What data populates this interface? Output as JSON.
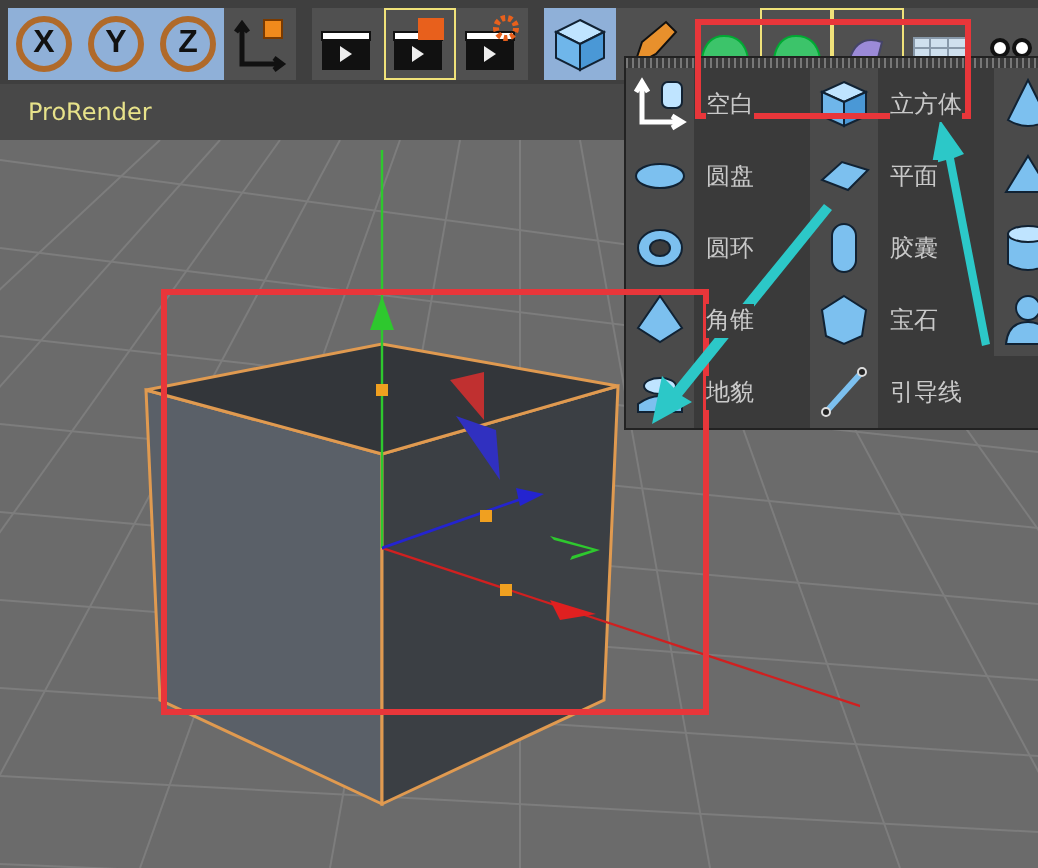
{
  "toolbar": {
    "groups": [
      {
        "items": [
          {
            "kind": "axis",
            "label": "X",
            "selected": true,
            "outlined": false
          },
          {
            "kind": "axis",
            "label": "Y",
            "selected": true,
            "outlined": false
          },
          {
            "kind": "axis",
            "label": "Z",
            "selected": true,
            "outlined": false
          },
          {
            "kind": "coord",
            "selected": false,
            "outlined": false
          }
        ]
      },
      {
        "items": [
          {
            "kind": "clap",
            "selected": false,
            "outlined": false
          },
          {
            "kind": "clap-edit",
            "selected": false,
            "outlined": true
          },
          {
            "kind": "clap-gear",
            "selected": false,
            "outlined": false
          }
        ]
      },
      {
        "items": [
          {
            "kind": "cube",
            "selected": true,
            "outlined": false
          },
          {
            "kind": "pen",
            "selected": false,
            "outlined": false
          },
          {
            "kind": "green",
            "selected": false,
            "outlined": false
          },
          {
            "kind": "green",
            "selected": false,
            "outlined": true
          },
          {
            "kind": "purple",
            "selected": false,
            "outlined": true
          },
          {
            "kind": "grid",
            "selected": false,
            "outlined": false
          },
          {
            "kind": "eyes",
            "selected": false,
            "outlined": false
          }
        ]
      }
    ]
  },
  "viewport": {
    "tab": "ProRender"
  },
  "menu": {
    "columns": [
      [
        {
          "kind": "null",
          "label": "空白"
        },
        {
          "kind": "disc",
          "label": "圆盘"
        },
        {
          "kind": "torus",
          "label": "圆环"
        },
        {
          "kind": "pyramid",
          "label": "角锥"
        },
        {
          "kind": "landscape",
          "label": "地貌"
        }
      ],
      [
        {
          "kind": "cube",
          "label": "立方体"
        },
        {
          "kind": "plane",
          "label": "平面"
        },
        {
          "kind": "capsule",
          "label": "胶囊"
        },
        {
          "kind": "gem",
          "label": "宝石"
        },
        {
          "kind": "guide",
          "label": "引导线"
        }
      ],
      [
        {
          "kind": "cone"
        },
        {
          "kind": "tetra"
        },
        {
          "kind": "cylinder"
        },
        {
          "kind": "figure"
        }
      ]
    ]
  }
}
